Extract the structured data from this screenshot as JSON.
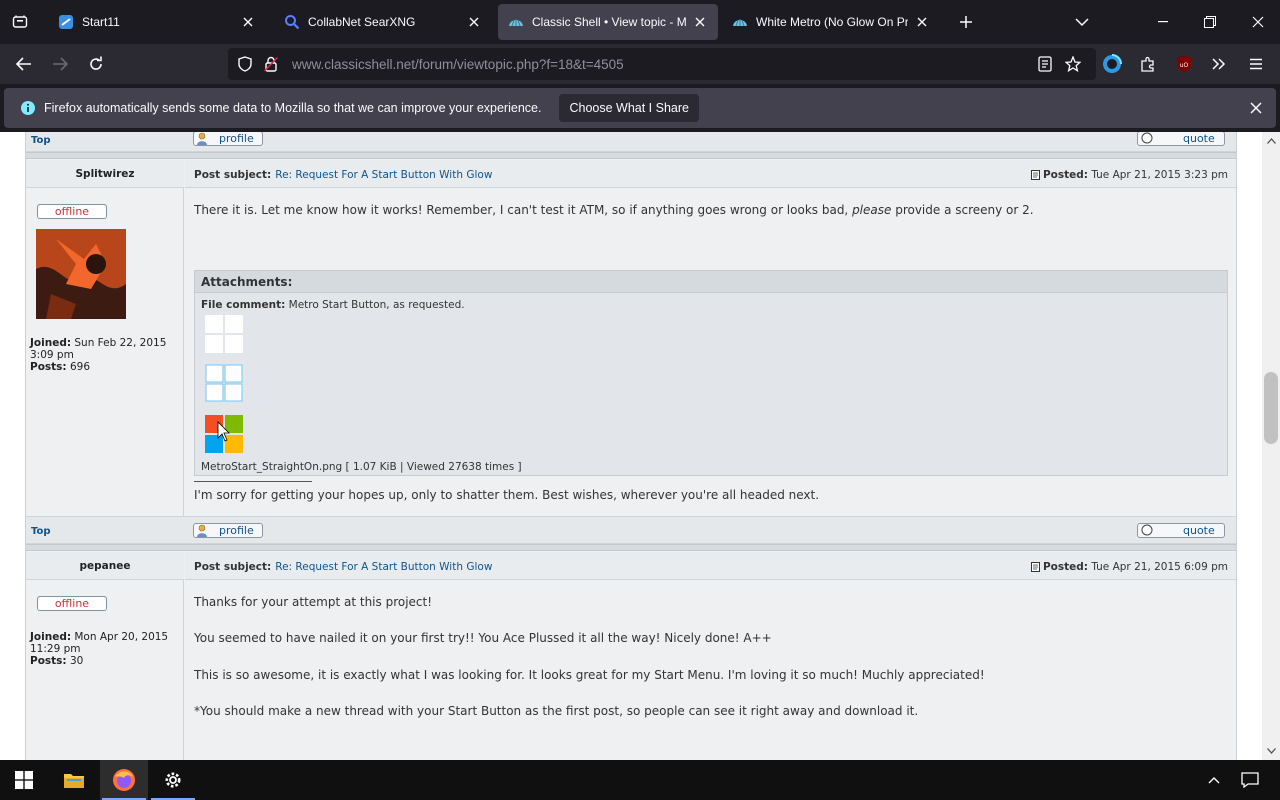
{
  "tabs": [
    {
      "title": "Start11",
      "active": false
    },
    {
      "title": "CollabNet SearXNG",
      "active": false
    },
    {
      "title": "Classic Shell • View topic - Micro",
      "active": true
    },
    {
      "title": "White Metro (No Glow On Press)",
      "active": false
    }
  ],
  "address": {
    "url": "www.classicshell.net/forum/viewtopic.php?f=18&t=4505"
  },
  "notification": {
    "message": "Firefox automatically sends some data to Mozilla so that we can improve your experience.",
    "button": "Choose What I Share"
  },
  "forum": {
    "top_label": "Top",
    "profile_label": "profile",
    "quote_label": "quote",
    "subject_prefix": "Post subject:",
    "posted_prefix": "Posted:",
    "offline_label": "offline",
    "joined_label": "Joined:",
    "posts_label": "Posts:",
    "posts": [
      {
        "author": "Splitwirez",
        "subject": "Re: Request For A Start Button With Glow",
        "posted": "Tue Apr 21, 2015 3:23 pm",
        "joined": "Sun Feb 22, 2015 3:09 pm",
        "post_count": "696",
        "body": "There it is. Let me know how it works! Remember, I can't test it ATM, so if anything goes wrong or looks bad, ",
        "body_em": "please",
        "body_end": " provide a screeny or 2.",
        "attachment": {
          "header": "Attachments:",
          "comment_label": "File comment:",
          "comment": "Metro Start Button, as requested.",
          "file": "MetroStart_StraightOn.png [ 1.07 KiB | Viewed 27638 times ]"
        },
        "signature": "I'm sorry for getting your hopes up, only to shatter them. Best wishes, wherever you're all headed next."
      },
      {
        "author": "pepanee",
        "subject": "Re: Request For A Start Button With Glow",
        "posted": "Tue Apr 21, 2015 6:09 pm",
        "joined": "Mon Apr 20, 2015 11:29 pm",
        "post_count": "30",
        "lines": [
          "Thanks for your attempt at this project!",
          "You seemed to have nailed it on your first try!! You Ace Plussed it all the way! Nicely done! A++",
          "This is so awesome, it is exactly what I was looking for. It looks great for my Start Menu. I'm loving it so much! Muchly appreciated!",
          "*You should make a new thread with your Start Button as the first post, so people can see it right away and download it."
        ]
      }
    ]
  },
  "colors": {
    "accent": "#0060df",
    "link": "#105289",
    "offline": "#cc3333"
  },
  "taskbar": {
    "apps": [
      "start-icon",
      "file-explorer-icon",
      "firefox-icon",
      "settings-icon"
    ]
  }
}
